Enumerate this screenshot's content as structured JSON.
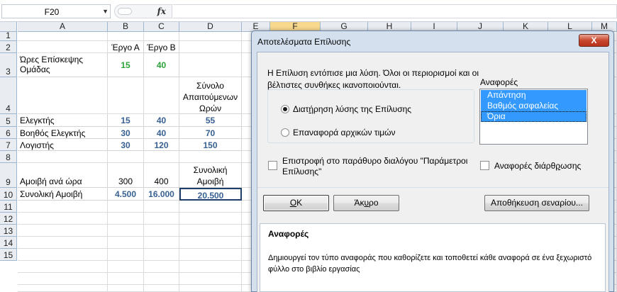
{
  "formula_bar": {
    "name_box": "F20",
    "fx_label": "fx",
    "formula": ""
  },
  "columns": [
    "A",
    "B",
    "C",
    "D",
    "E",
    "F",
    "G",
    "H",
    "I",
    "J",
    "K",
    "L",
    "M"
  ],
  "rows": [
    "1",
    "2",
    "3",
    "4",
    "5",
    "6",
    "7",
    "8",
    "9",
    "10",
    "11",
    "12",
    "13",
    "14",
    "15"
  ],
  "sheet": {
    "b2": "Έργο Α",
    "c2": "Έργο Β",
    "a3": "Ώρες Επίσκεψης Ομάδας",
    "b3": "15",
    "c3": "40",
    "d4": "Σύνολο Απαιτούμενων Ωρών",
    "a5": "Ελεγκτής",
    "b5": "15",
    "c5": "40",
    "d5": "55",
    "a6": "Βοηθός Ελεγκτής",
    "b6": "30",
    "c6": "40",
    "d6": "70",
    "a7": "Λογιστής",
    "b7": "30",
    "c7": "120",
    "d7": "150",
    "a9": "Αμοιβή ανά ώρα",
    "b9": "300",
    "c9": "400",
    "d9": "Συνολική Αμοιβή",
    "a10": "Συνολική Αμοιβή",
    "b10": "4.500",
    "c10": "16.000",
    "d10": "20.500"
  },
  "dialog": {
    "title": "Αποτελέσματα Επίλυσης",
    "close": "X",
    "message": "Η Επίλυση εντόπισε μια λύση. Όλοι οι περιορισμοί και οι βέλτιστες συνθήκες ικανοποιούνται.",
    "reports_label": "Αναφορές",
    "reports": [
      "Απάντηση",
      "Βαθμός ασφαλείας",
      "Όρια"
    ],
    "radio_keep_pre": "Διατ",
    "radio_keep_key": "ή",
    "radio_keep_post": "ρηση λύσης της Επίλυσης",
    "radio_restore": "Επαναφορά αρχικών τιμών",
    "check_return": "Επιστροφή στο παράθυρο διαλόγου \"Παράμετροι Επίλυσης\"",
    "check_outline_pre": "Αναφορές διάρθ",
    "check_outline_key": "ρ",
    "check_outline_post": "ωσης",
    "ok_key": "O",
    "ok_rest": "K",
    "cancel_pre": "Άκ",
    "cancel_key": "υ",
    "cancel_post": "ρο",
    "save": "Αποθήκευση σεναρίου...",
    "desc_title": "Αναφορές",
    "desc_text": "Δημιουργεί τον τύπο αναφοράς που καθορίζετε και τοποθετεί κάθε αναφορά σε ένα ξεχωριστό φύλλο στο βιβλίο εργασίας"
  }
}
